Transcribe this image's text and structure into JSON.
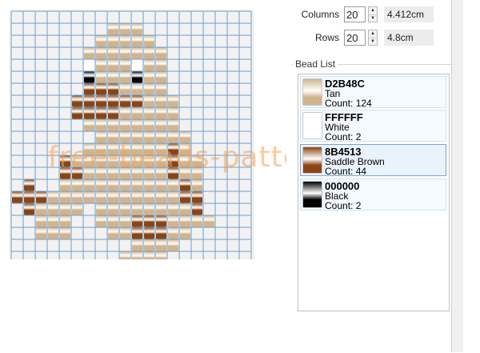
{
  "grid": {
    "columns": 20,
    "rows": 20,
    "pattern": [
      "....................",
      "........TTT.........",
      ".......TTTTT........",
      "......TTTTTTT.......",
      "......WTTTWTT.......",
      "......KTTTKTT.......",
      "......BBBTTTT.......",
      ".....BBBBBBTTT......",
      ".....BBBBTTTTT......",
      "......TTTTTTTT......",
      ".......TTTTTTTT.....",
      "......TTTTTTTBT.....",
      "....BTTTTTTTTBTT....",
      "....BBTTTTTTTBTT....",
      ".B..TTTTTTTTTTBT....",
      "BBBTTTTTTTTTTTBB....",
      ".BTTTT.TTTTTTTTB....",
      "..TTT..TTTBBBTTTT...",
      "..TTT...TTBBBTT.....",
      "..........TTTT......",
      ".........TTTT......."
    ],
    "legend": {
      "T": "#D2B48C",
      "W": "#FFFFFF",
      "B": "#8B4513",
      "K": "#000000"
    }
  },
  "watermark": "free-beads-patterns.com",
  "settings": {
    "columns_label": "Columns",
    "columns_value": "20",
    "columns_cm": "4.412cm",
    "rows_label": "Rows",
    "rows_value": "20",
    "rows_cm": "4.8cm"
  },
  "bead_list": {
    "title": "Bead List",
    "items": [
      {
        "hex": "D2B48C",
        "name": "Tan",
        "count": "Count: 124",
        "color": "#D2B48C"
      },
      {
        "hex": "FFFFFF",
        "name": "White",
        "count": "Count: 2",
        "color": "#FFFFFF"
      },
      {
        "hex": "8B4513",
        "name": "Saddle Brown",
        "count": "Count: 44",
        "color": "#8B4513"
      },
      {
        "hex": "000000",
        "name": "Black",
        "count": "Count: 2",
        "color": "#000000"
      }
    ]
  }
}
